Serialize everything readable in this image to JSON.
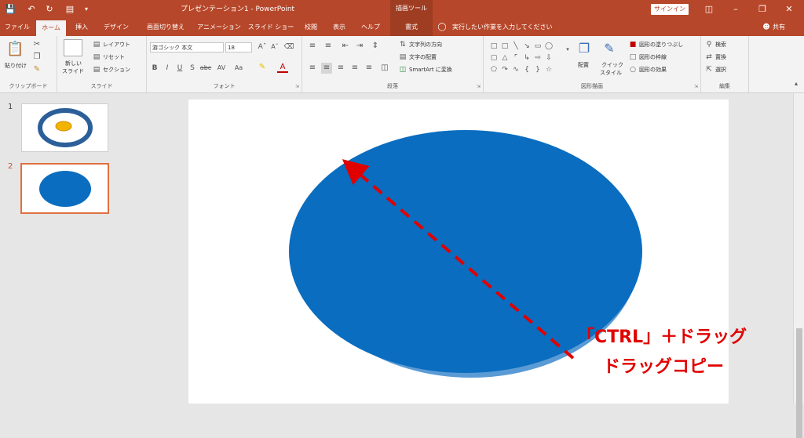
{
  "titlebar": {
    "title": "プレゼンテーション1 - PowerPoint",
    "tool_context": "描画ツール",
    "signin": "サインイン",
    "icons": [
      "save-icon",
      "undo-icon",
      "redo-icon",
      "presentation-icon",
      "customize-icon",
      "ribbon-display-icon",
      "minimize-icon",
      "restore-icon",
      "close-icon"
    ]
  },
  "tabs": [
    {
      "label": "ファイル"
    },
    {
      "label": "ホーム"
    },
    {
      "label": "挿入"
    },
    {
      "label": "デザイン"
    },
    {
      "label": "画面切り替え"
    },
    {
      "label": "アニメーション"
    },
    {
      "label": "スライド ショー"
    },
    {
      "label": "校閲"
    },
    {
      "label": "表示"
    },
    {
      "label": "ヘルプ"
    },
    {
      "label": "書式"
    }
  ],
  "tell_me": "実行したい作業を入力してください",
  "share": "共有",
  "ribbon": {
    "clipboard": {
      "label": "クリップボード",
      "paste": "貼り付け"
    },
    "slides": {
      "label": "スライド",
      "new_slide_line1": "新しい",
      "new_slide_line2": "スライド",
      "layout": "レイアウト",
      "reset": "リセット",
      "section": "セクション"
    },
    "font": {
      "label": "フォント",
      "font_name": "游ゴシック 本文",
      "font_size": "18",
      "buttons": [
        "B",
        "I",
        "U",
        "S",
        "abc",
        "AV",
        "Aa",
        "A"
      ]
    },
    "paragraph": {
      "label": "段落",
      "text_direction": "文字列の方向",
      "align_text": "文字の配置",
      "smartart": "SmartArt に変換"
    },
    "drawing": {
      "label": "図形描画",
      "arrange": "配置",
      "quick_styles_line1": "クイック",
      "quick_styles_line2": "スタイル",
      "shape_fill": "図形の塗りつぶし",
      "shape_outline": "図形の枠線",
      "shape_effects": "図形の効果"
    },
    "editing": {
      "label": "編集",
      "find": "検索",
      "replace": "置換",
      "select": "選択"
    }
  },
  "slides_panel": [
    {
      "number": "1",
      "content": "fried-egg"
    },
    {
      "number": "2",
      "content": "blue-ellipse"
    }
  ],
  "slide": {
    "shape_color": "#0a6dbf",
    "copy_color": "#5b9bd5",
    "caption_line1": "「CTRL」＋ドラッグ",
    "caption_line2": "ドラッグコピー",
    "annotation_color": "#e00000"
  }
}
